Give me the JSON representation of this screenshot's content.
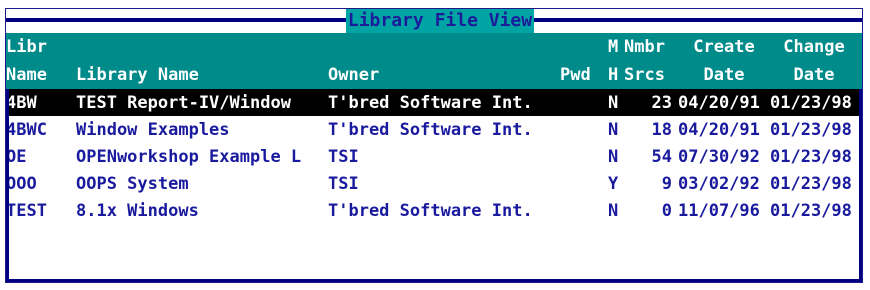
{
  "window": {
    "title": "Library File View"
  },
  "columns": {
    "libr_line1": "Libr",
    "libr_line2": "Name",
    "name": "Library Name",
    "owner": "Owner",
    "pwd": "Pwd",
    "mh_line1": "M",
    "mh_line2": "H",
    "nmbr_line1": "Nmbr",
    "nmbr_line2": "Srcs",
    "create_line1": "Create",
    "create_line2": "Date",
    "change_line1": "Change",
    "change_line2": "Date"
  },
  "rows": [
    {
      "lib": "4BW",
      "name": "TEST Report-IV/Window",
      "owner": "T'bred Software Int.",
      "pwd": "",
      "mh": "N",
      "srcs": "23",
      "created": "04/20/91",
      "changed": "01/23/98"
    },
    {
      "lib": "4BWC",
      "name": "Window Examples",
      "owner": "T'bred Software Int.",
      "pwd": "",
      "mh": "N",
      "srcs": "18",
      "created": "04/20/91",
      "changed": "01/23/98"
    },
    {
      "lib": "OE",
      "name": "OPENworkshop Example L",
      "owner": "TSI",
      "pwd": "",
      "mh": "N",
      "srcs": "54",
      "created": "07/30/92",
      "changed": "01/23/98"
    },
    {
      "lib": "OOO",
      "name": "OOPS System",
      "owner": "TSI",
      "pwd": "",
      "mh": "Y",
      "srcs": "9",
      "created": "03/02/92",
      "changed": "01/23/98"
    },
    {
      "lib": "TEST",
      "name": "8.1x Windows",
      "owner": "T'bred Software Int.",
      "pwd": "",
      "mh": "N",
      "srcs": "0",
      "created": "11/07/96",
      "changed": "01/23/98"
    }
  ],
  "selected_row": 0,
  "colors": {
    "header_bg": "#008b8b",
    "title_bg": "#00a4a4",
    "row_text": "#1a1a9e",
    "selected_bg": "#000000",
    "frame": "#000080"
  }
}
